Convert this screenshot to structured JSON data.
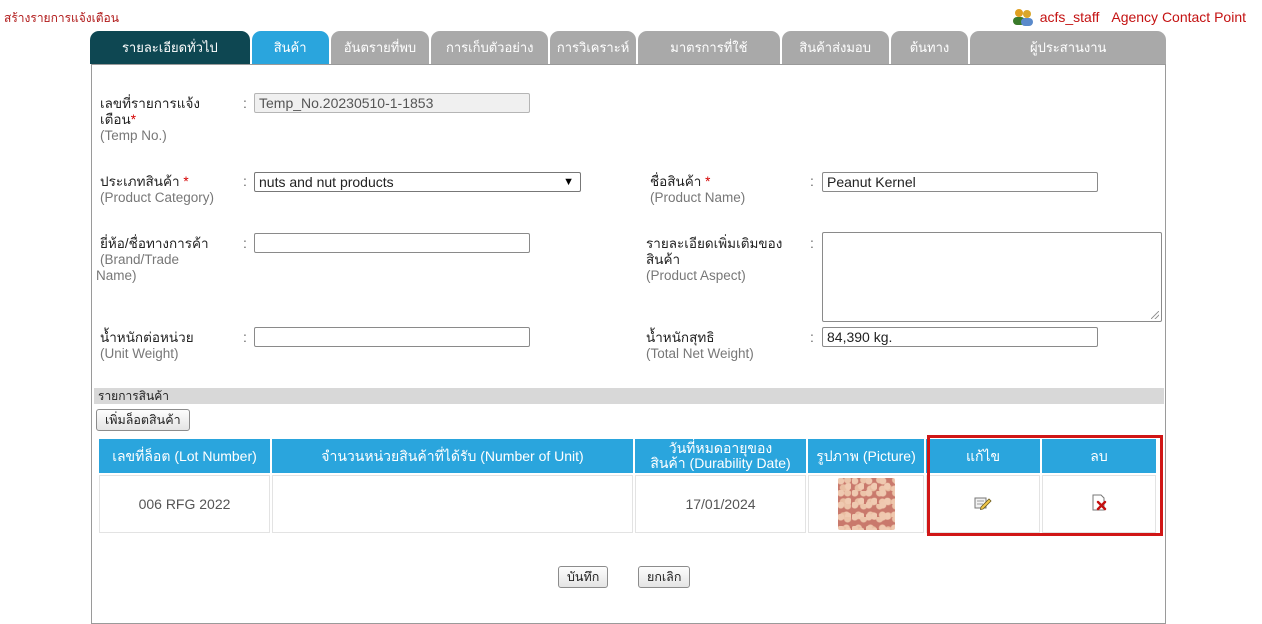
{
  "page": {
    "title": "สร้างรายการแจ้งเตือน"
  },
  "user": {
    "name": "acfs_staff",
    "agency": "Agency Contact Point"
  },
  "tabs": [
    {
      "label": "รายละเอียดทั่วไป",
      "state": "active"
    },
    {
      "label": "สินค้า",
      "state": "selected"
    },
    {
      "label": "อันตรายที่พบ",
      "state": "inactive"
    },
    {
      "label": "การเก็บตัวอย่าง",
      "state": "inactive"
    },
    {
      "label": "การวิเคราะห์",
      "state": "inactive"
    },
    {
      "label": "มาตรการที่ใช้",
      "state": "inactive"
    },
    {
      "label": "สินค้าส่งมอบ",
      "state": "inactive"
    },
    {
      "label": "ต้นทาง",
      "state": "inactive"
    },
    {
      "label": "ผู้ประสานงาน",
      "state": "inactive"
    }
  ],
  "form": {
    "temp_no": {
      "label_th": "เลขที่รายการแจ้ง",
      "label_th2": "เตือน",
      "label_en": "(Temp No.)",
      "value": "Temp_No.20230510-1-1853"
    },
    "category": {
      "label_th": "ประเภทสินค้า",
      "label_en": "(Product Category)",
      "value": "nuts and nut products"
    },
    "product_name": {
      "label_th": "ชื่อสินค้า",
      "label_en": "(Product Name)",
      "value": "Peanut Kernel"
    },
    "brand": {
      "label_th": "ยี่ห้อ/ชื่อทางการค้า",
      "label_en": "(Brand/Trade",
      "label_en2": "Name)",
      "value": ""
    },
    "aspect": {
      "label_th": "รายละเอียดเพิ่มเติมของ",
      "label_th2": "สินค้า",
      "label_en": "(Product Aspect)",
      "value": ""
    },
    "unit_weight": {
      "label_th": "น้ำหนักต่อหน่วย",
      "label_en": "(Unit Weight)",
      "value": ""
    },
    "net_weight": {
      "label_th": "น้ำหนักสุทธิ",
      "label_en": "(Total Net Weight)",
      "value": "84,390 kg."
    },
    "required_mark": "*",
    "colon": ":"
  },
  "items_section": {
    "title": "รายการสินค้า",
    "add_lot_label": "เพิ่มล็อตสินค้า",
    "columns": [
      "เลขที่ล็อต (Lot Number)",
      "จำนวนหน่วยสินค้าที่ได้รับ (Number of Unit)",
      "วันที่หมดอายุของ",
      "สินค้า (Durability Date)",
      "รูปภาพ (Picture)",
      "แก้ไข",
      "ลบ"
    ],
    "rows": [
      {
        "lot": "006 RFG 2022",
        "units": "",
        "durability": "17/01/2024",
        "picture_icon": "peanut-photo",
        "edit_icon": "edit-icon",
        "delete_icon": "delete-icon"
      }
    ]
  },
  "actions": {
    "save_label": "บันทึก",
    "cancel_label": "ยกเลิก"
  },
  "colors": {
    "accent_blue": "#2aa5dd",
    "active_tab": "#0e4752",
    "inactive_tab": "#a9a9a9",
    "highlight": "#d01616",
    "title_red": "#b01818"
  }
}
